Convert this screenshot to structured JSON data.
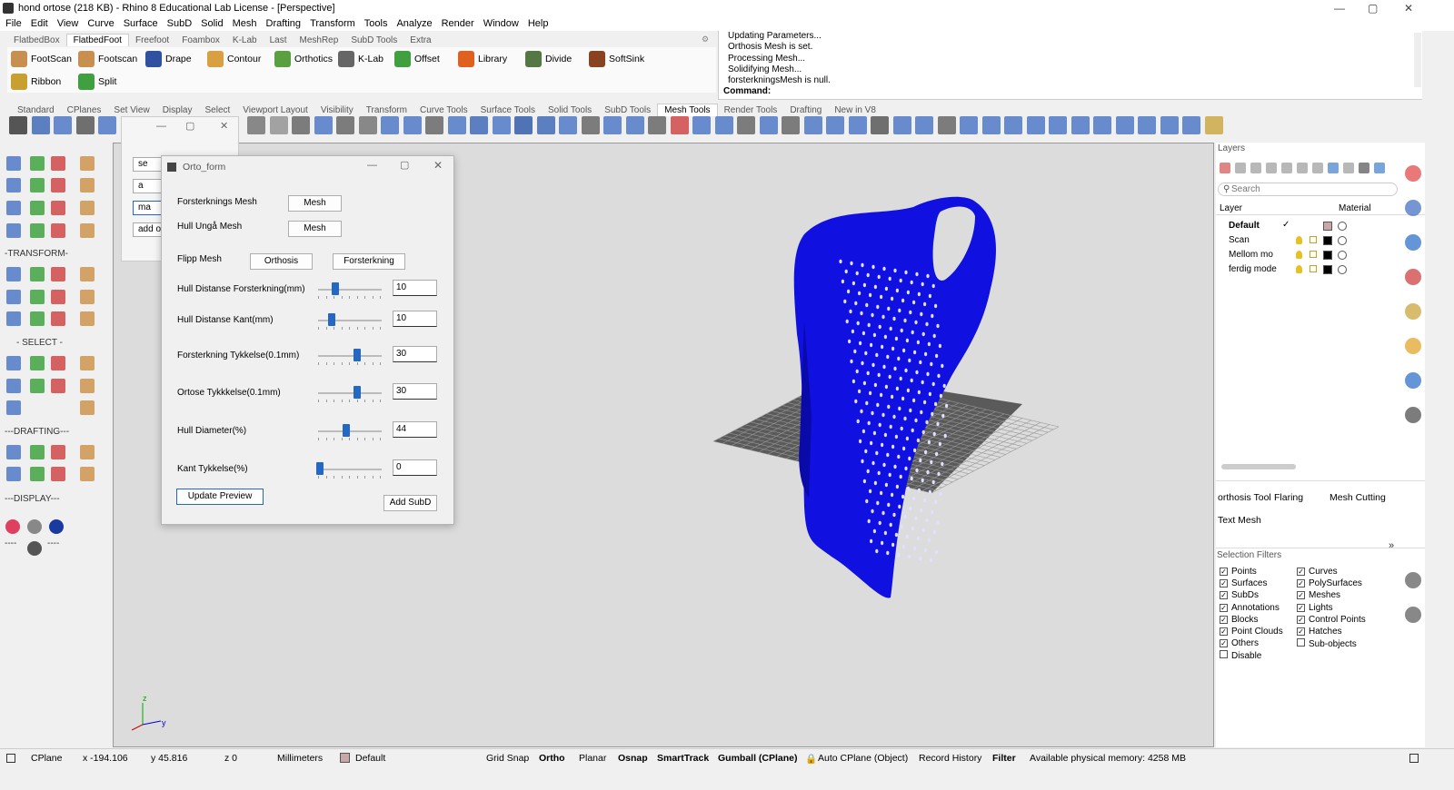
{
  "window": {
    "title": "hond ortose (218 KB) - Rhino 8 Educational Lab License - [Perspective]"
  },
  "menu": [
    "File",
    "Edit",
    "View",
    "Curve",
    "Surface",
    "SubD",
    "Solid",
    "Mesh",
    "Drafting",
    "Transform",
    "Tools",
    "Analyze",
    "Render",
    "Window",
    "Help"
  ],
  "plugin_tabs": [
    "FlatbedBox",
    "FlatbedFoot",
    "Freefoot",
    "Foambox",
    "K-Lab",
    "Last",
    "MeshRep",
    "SubD Tools",
    "Extra"
  ],
  "plugin_buttons_row1": [
    "FootScan",
    "Footscan",
    "Drape",
    "Contour",
    "Orthotics",
    "K-Lab",
    "Offset",
    "Library",
    "Divide",
    "SoftSink"
  ],
  "plugin_buttons_row2": [
    "Ribbon",
    "Split"
  ],
  "command_history": [
    "Updating Parameters...",
    "Orthosis Mesh is set.",
    "Processing Mesh...",
    "Solidifying Mesh...",
    "forsterkningsMesh is null."
  ],
  "command_prompt": "Command:",
  "main_tabs": [
    "Standard",
    "CPlanes",
    "Set View",
    "Display",
    "Select",
    "Viewport Layout",
    "Visibility",
    "Transform",
    "Curve Tools",
    "Surface Tools",
    "Solid Tools",
    "SubD Tools",
    "Mesh Tools",
    "Render Tools",
    "Drafting",
    "New in V8"
  ],
  "active_main_tab": "Mesh Tools",
  "left_toolbar_labels": {
    "transform": "-TRANSFORM-",
    "select": "- SELECT -",
    "drafting": "---DRAFTING---",
    "display": "---DISPLAY---",
    "dashes1": "----",
    "dashes2": "----"
  },
  "bg_dialog_buttons": [
    "se",
    "a",
    "ma",
    "add o"
  ],
  "dialog": {
    "title": "Orto_form",
    "forsterkning_mesh_label": "Forsterknings Mesh",
    "forsterkning_mesh_btn": "Mesh",
    "hull_unga_label": "Hull Ungå Mesh",
    "hull_unga_btn": "Mesh",
    "flipp_label": "Flipp Mesh",
    "flipp_orthosis": "Orthosis",
    "flipp_forsterkning": "Forsterkning",
    "sliders": [
      {
        "label": "Hull Distanse Forsterkning(mm)",
        "value": "10",
        "level": 0.25
      },
      {
        "label": "Hull Distanse Kant(mm)",
        "value": "10",
        "level": 0.2
      },
      {
        "label": "Forsterkning Tykkelse(0.1mm)",
        "value": "30",
        "level": 0.62
      },
      {
        "label": "Ortose Tykkkelse(0.1mm)",
        "value": "30",
        "level": 0.62
      },
      {
        "label": "Hull Diameter(%)",
        "value": "44",
        "level": 0.44
      },
      {
        "label": "Kant Tykkelse(%)",
        "value": "0",
        "level": 0.0
      }
    ],
    "update_btn": "Update Preview",
    "add_subd_btn": "Add SubD"
  },
  "layers": {
    "title": "Layers",
    "search_placeholder": "Search",
    "col_layer": "Layer",
    "col_material": "Material",
    "rows": [
      {
        "name": "Default",
        "current": true,
        "color": "#c8a8a8"
      },
      {
        "name": "Scan",
        "current": false,
        "color": "#000000"
      },
      {
        "name": "Mellom mo",
        "current": false,
        "color": "#000000"
      },
      {
        "name": "ferdig mode",
        "current": false,
        "color": "#000000"
      }
    ]
  },
  "panel_tabs": [
    "orthosis Tool",
    "Flaring",
    "Mesh Cutting",
    "Text Mesh"
  ],
  "selection_filters": {
    "title": "Selection Filters",
    "left": [
      {
        "label": "Points",
        "checked": true
      },
      {
        "label": "Surfaces",
        "checked": true
      },
      {
        "label": "SubDs",
        "checked": true
      },
      {
        "label": "Annotations",
        "checked": true
      },
      {
        "label": "Blocks",
        "checked": true
      },
      {
        "label": "Point Clouds",
        "checked": true
      },
      {
        "label": "Others",
        "checked": true
      },
      {
        "label": "Disable",
        "checked": false
      }
    ],
    "right": [
      {
        "label": "Curves",
        "checked": true
      },
      {
        "label": "PolySurfaces",
        "checked": true
      },
      {
        "label": "Meshes",
        "checked": true
      },
      {
        "label": "Lights",
        "checked": true
      },
      {
        "label": "Control Points",
        "checked": true
      },
      {
        "label": "Hatches",
        "checked": true
      },
      {
        "label": "Sub-objects",
        "checked": false
      }
    ]
  },
  "axes": {
    "z": "z",
    "y": "y"
  },
  "status": {
    "cplane": "CPlane",
    "x": "x -194.106",
    "y": "y 45.816",
    "z": "z 0",
    "units": "Millimeters",
    "layer": "Default",
    "grid_snap": "Grid Snap",
    "ortho": "Ortho",
    "planar": "Planar",
    "osnap": "Osnap",
    "smarttrack": "SmartTrack",
    "gumball": "Gumball (CPlane)",
    "auto_cplane": "Auto CPlane (Object)",
    "record_history": "Record History",
    "filter": "Filter",
    "memory": "Available physical memory: 4258 MB"
  },
  "colors": {
    "mesh": "#1010e0",
    "viewport": "#dcdcdc",
    "accent": "#2268c4"
  }
}
